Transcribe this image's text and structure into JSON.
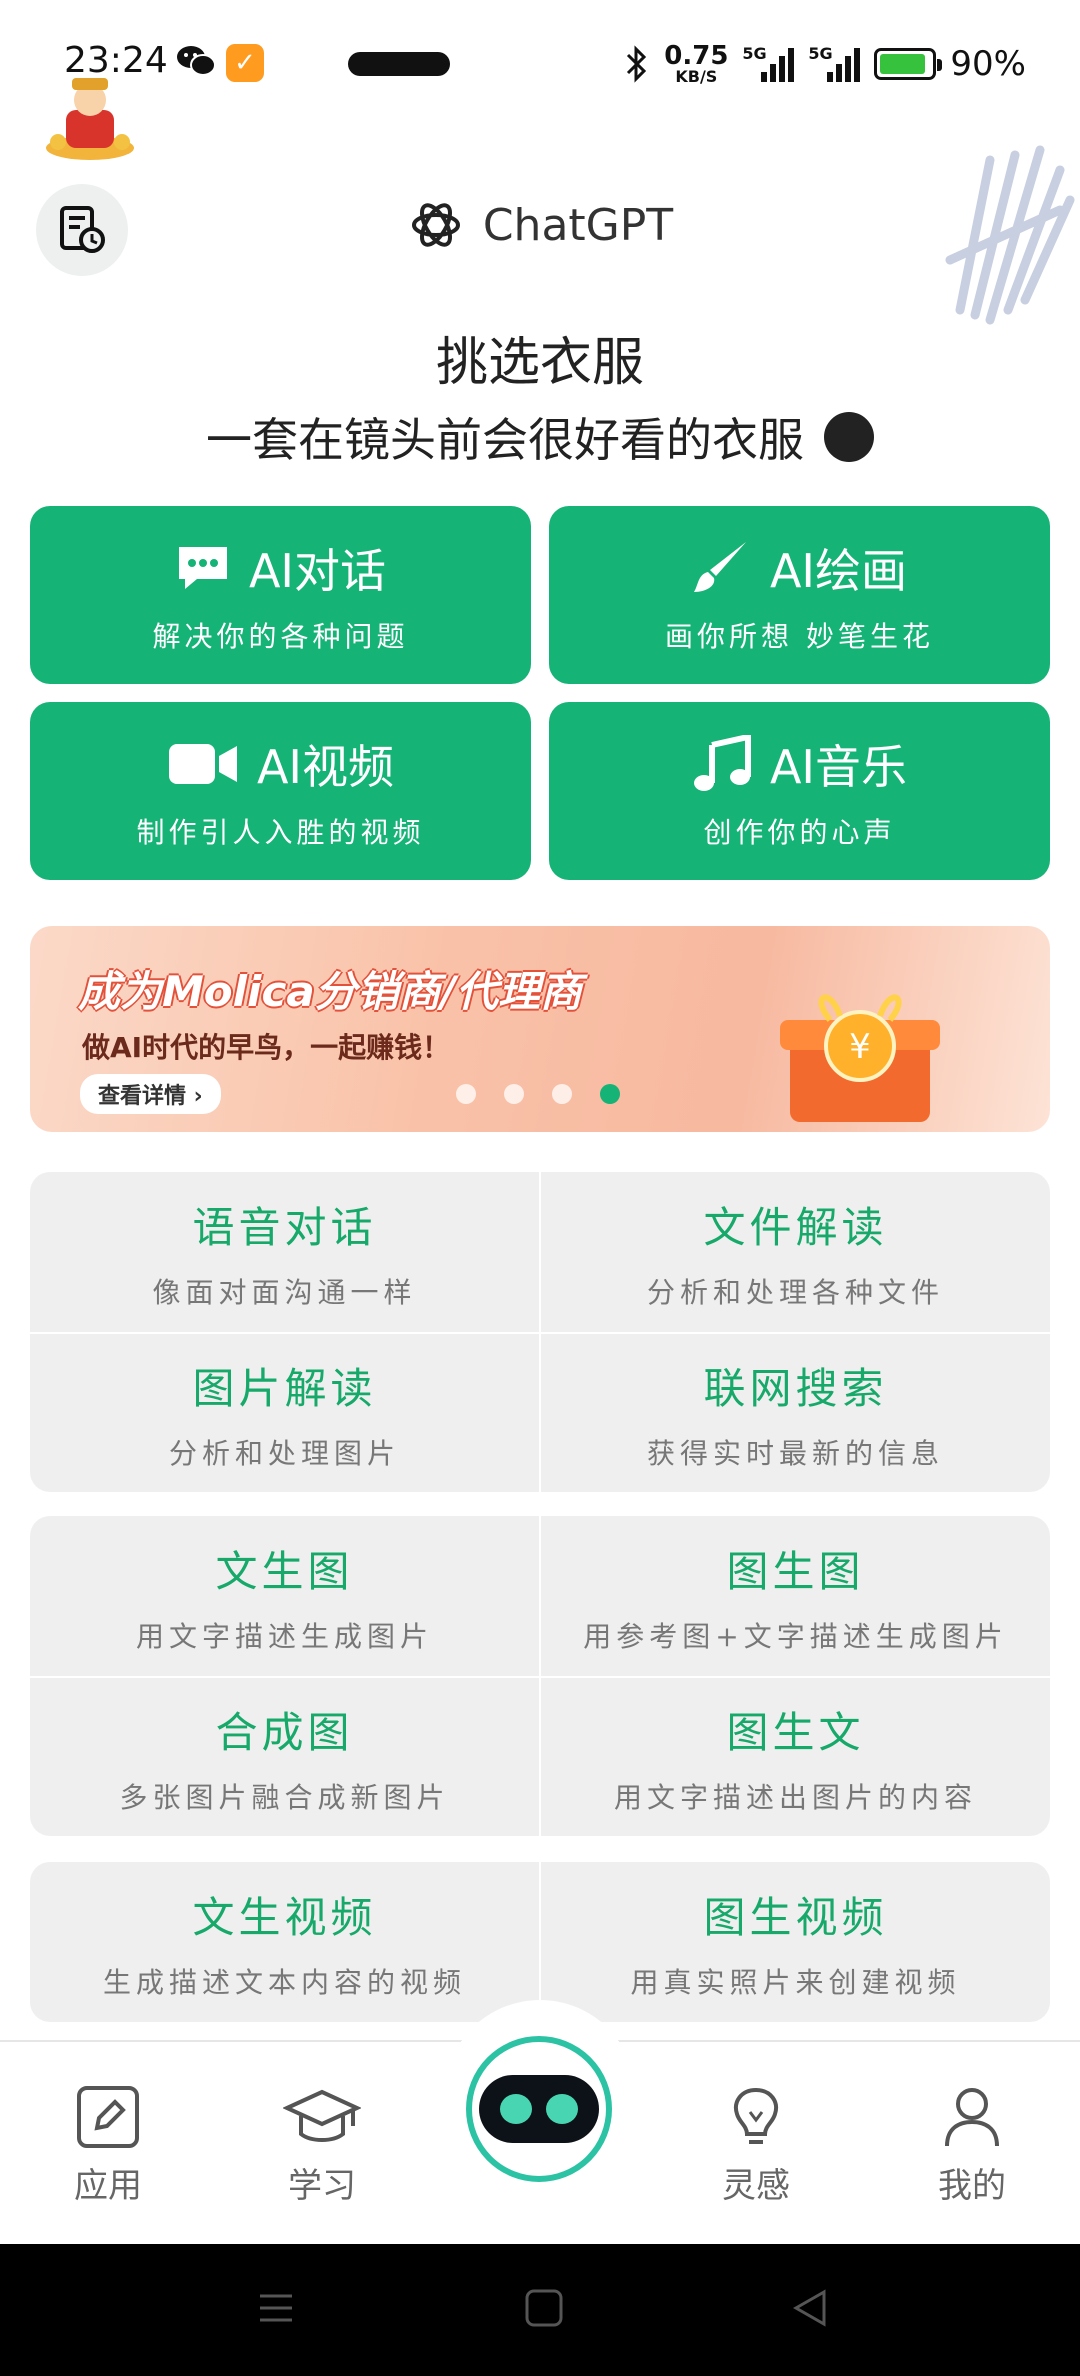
{
  "status_bar": {
    "time": "23:24",
    "speed_value": "0.75",
    "speed_unit": "KB/S",
    "net1": "5G",
    "net2": "5G",
    "battery_pct": "90%",
    "battery_level": 0.9,
    "app_icon": "checkmark-icon"
  },
  "header": {
    "brand": "ChatGPT",
    "history_icon": "history-doc-icon"
  },
  "prompt": {
    "line1": "挑选衣服",
    "line2": "一套在镜头前会很好看的衣服"
  },
  "features": [
    {
      "title": "AI对话",
      "subtitle": "解决你的各种问题",
      "icon": "chat-bubble-icon"
    },
    {
      "title": "AI绘画",
      "subtitle": "画你所想 妙笔生花",
      "icon": "paintbrush-icon"
    },
    {
      "title": "AI视频",
      "subtitle": "制作引人入胜的视频",
      "icon": "video-camera-icon"
    },
    {
      "title": "AI音乐",
      "subtitle": "创作你的心声",
      "icon": "music-note-icon"
    }
  ],
  "banner": {
    "title": "成为Molica分销商/代理商",
    "subtitle": "做AI时代的早鸟，一起赚钱！",
    "button": "查看详情 ›",
    "dot_count": 4,
    "active_dot": 4
  },
  "panels": [
    [
      {
        "title": "语音对话",
        "subtitle": "像面对面沟通一样"
      },
      {
        "title": "文件解读",
        "subtitle": "分析和处理各种文件"
      },
      {
        "title": "图片解读",
        "subtitle": "分析和处理图片"
      },
      {
        "title": "联网搜索",
        "subtitle": "获得实时最新的信息"
      }
    ],
    [
      {
        "title": "文生图",
        "subtitle": "用文字描述生成图片"
      },
      {
        "title": "图生图",
        "subtitle": "用参考图+文字描述生成图片"
      },
      {
        "title": "合成图",
        "subtitle": "多张图片融合成新图片"
      },
      {
        "title": "图生文",
        "subtitle": "用文字描述出图片的内容"
      }
    ],
    [
      {
        "title": "文生视频",
        "subtitle": "生成描述文本内容的视频"
      },
      {
        "title": "图生视频",
        "subtitle": "用真实照片来创建视频"
      }
    ]
  ],
  "nav": {
    "app": "应用",
    "learn": "学习",
    "inspire": "灵感",
    "mine": "我的"
  },
  "colors": {
    "accent": "#16b377",
    "panel_text": "#17a96a",
    "robot_ring": "#2cc3a5"
  }
}
